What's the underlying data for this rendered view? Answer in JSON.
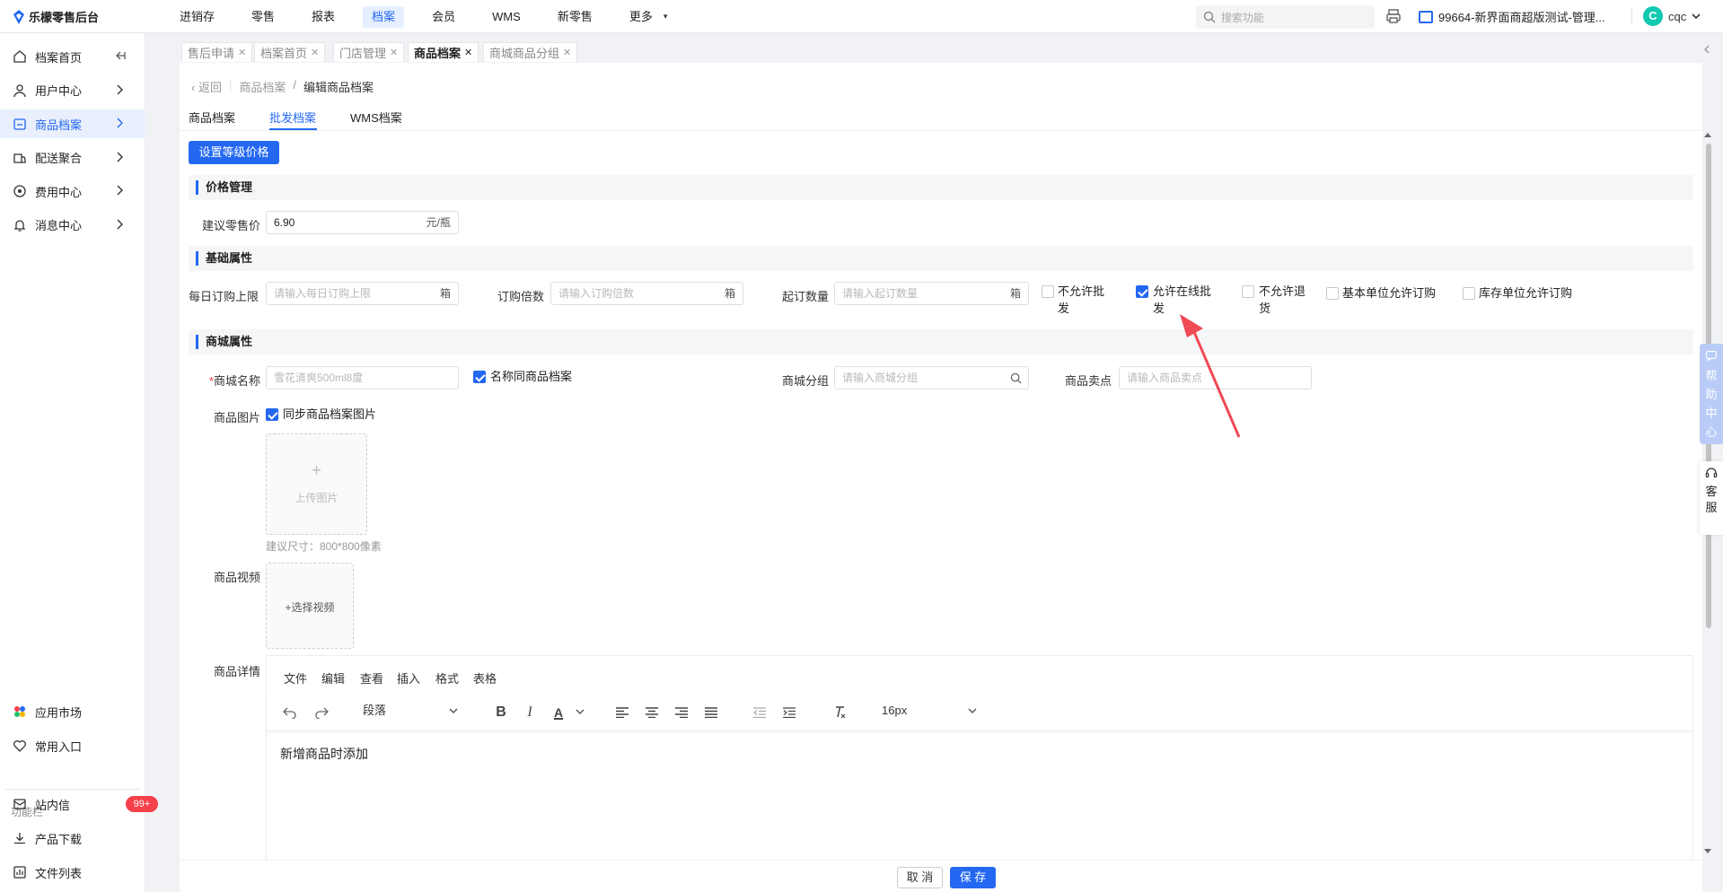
{
  "app": {
    "logo_text": "乐檬零售后台"
  },
  "topnav": {
    "items": [
      "进销存",
      "零售",
      "报表",
      "档案",
      "会员",
      "WMS",
      "新零售",
      "更多"
    ],
    "active_index": 3
  },
  "header": {
    "search_placeholder": "搜索功能",
    "store_name": "99664-新界面商超版测试-管理...",
    "user_initial": "C",
    "user_name": "cqc"
  },
  "sidebar": {
    "items": [
      {
        "label": "档案首页",
        "icon": "home-icon"
      },
      {
        "label": "用户中心",
        "icon": "user-icon"
      },
      {
        "label": "商品档案",
        "icon": "box-icon"
      },
      {
        "label": "配送聚合",
        "icon": "truck-icon"
      },
      {
        "label": "费用中心",
        "icon": "coin-icon"
      },
      {
        "label": "消息中心",
        "icon": "bell-icon"
      }
    ],
    "active_index": 2,
    "bottom_items": [
      {
        "label": "应用市场",
        "icon": "apps-icon"
      },
      {
        "label": "常用入口",
        "icon": "heart-icon"
      }
    ],
    "section_title": "功能栏",
    "func_items": [
      {
        "label": "站内信",
        "icon": "mail-icon",
        "badge": "99+"
      },
      {
        "label": "产品下载",
        "icon": "download-icon"
      },
      {
        "label": "文件列表",
        "icon": "filelist-icon"
      }
    ]
  },
  "tabs": [
    {
      "label": "售后申请",
      "active": false
    },
    {
      "label": "档案首页",
      "active": false
    },
    {
      "label": "门店管理",
      "active": false
    },
    {
      "label": "商品档案",
      "active": true
    },
    {
      "label": "商城商品分组",
      "active": false
    }
  ],
  "breadcrumb": {
    "back": "返回",
    "parent": "商品档案",
    "sep": "/",
    "current": "编辑商品档案"
  },
  "subtabs": [
    "商品档案",
    "批发档案",
    "WMS档案"
  ],
  "subtab_active": 1,
  "actions": {
    "set_level_price": "设置等级价格",
    "cancel": "取 消",
    "save": "保 存"
  },
  "price_section": {
    "title": "价格管理",
    "retail_label": "建议零售价",
    "retail_value": "6.90",
    "retail_unit": "元/瓶"
  },
  "basic_section": {
    "title": "基础属性",
    "daily_limit_label": "每日订购上限",
    "daily_limit_placeholder": "请输入每日订购上限",
    "daily_limit_unit": "箱",
    "multiple_label": "订购倍数",
    "multiple_placeholder": "请输入订购倍数",
    "multiple_unit": "箱",
    "min_qty_label": "起订数量",
    "min_qty_placeholder": "请输入起订数量",
    "min_qty_unit": "箱",
    "checks": [
      {
        "line1": "不允许批",
        "line2": "发",
        "checked": false
      },
      {
        "line1": "允许在线批",
        "line2": "发",
        "checked": true
      },
      {
        "line1": "不允许退",
        "line2": "货",
        "checked": false
      },
      {
        "line1": "基本单位允许订购",
        "line2": "",
        "checked": false
      },
      {
        "line1": "库存单位允许订购",
        "line2": "",
        "checked": false
      }
    ]
  },
  "mall_section": {
    "title": "商城属性",
    "required_mark": "*",
    "name_label": "商城名称",
    "name_placeholder": "雪花清爽500ml8度",
    "same_name_label": "名称同商品档案",
    "same_name_checked": true,
    "group_label": "商城分组",
    "group_placeholder": "请输入商城分组",
    "selling_point_label": "商品卖点",
    "selling_point_placeholder": "请输入商品卖点",
    "image_label": "商品图片",
    "sync_image_label": "同步商品档案图片",
    "sync_image_checked": true,
    "upload_plus": "+",
    "upload_text": "上传图片",
    "size_hint": "建议尺寸：800*800像素",
    "video_label": "商品视频",
    "video_text": "+选择视频",
    "detail_label": "商品详情"
  },
  "editor": {
    "menus": [
      "文件",
      "编辑",
      "查看",
      "插入",
      "格式",
      "表格"
    ],
    "paragraph": "段落",
    "font_size": "16px",
    "content": "新增商品时添加"
  },
  "float": {
    "help": [
      "帮",
      "助",
      "中",
      "心"
    ],
    "service": [
      "客",
      "服"
    ]
  },
  "colors": {
    "primary": "#2468f2",
    "badge": "#f5414a",
    "arrow": "#f04a55"
  }
}
